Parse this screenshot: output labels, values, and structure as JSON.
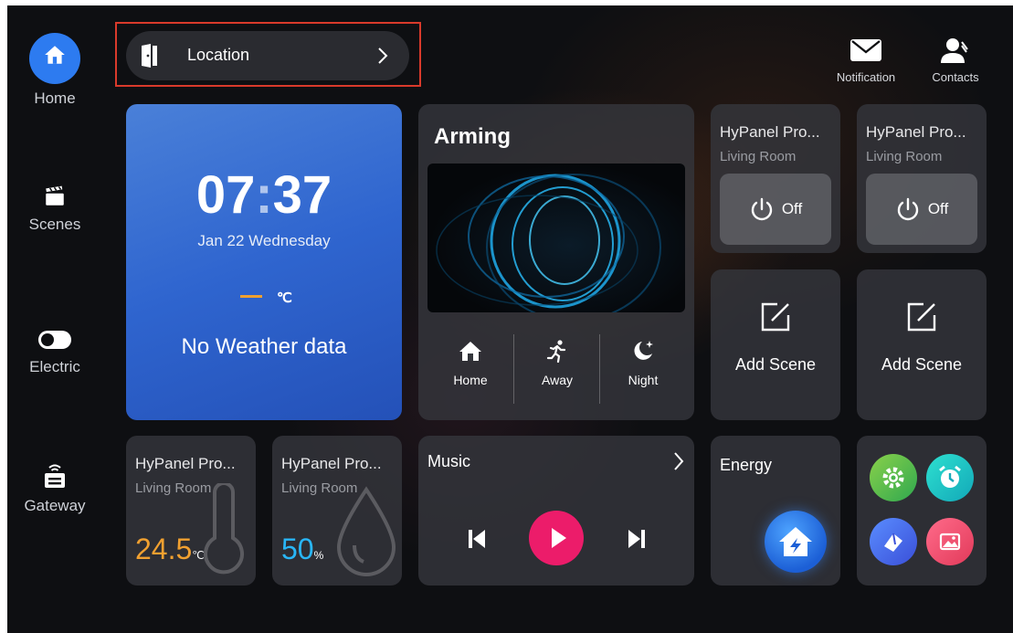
{
  "sidebar": {
    "items": [
      {
        "label": "Home",
        "icon": "home-icon"
      },
      {
        "label": "Scenes",
        "icon": "clapperboard-icon"
      },
      {
        "label": "Electric",
        "icon": "toggle-icon"
      },
      {
        "label": "Gateway",
        "icon": "gateway-icon"
      }
    ]
  },
  "header": {
    "location_label": "Location",
    "notification_label": "Notification",
    "contacts_label": "Contacts"
  },
  "clock": {
    "time_h": "07",
    "time_sep": ":",
    "time_m": "37",
    "date": "Jan 22 Wednesday",
    "temp_unit": "℃",
    "weather": "No Weather data"
  },
  "arming": {
    "title": "Arming",
    "modes": [
      "Home",
      "Away",
      "Night"
    ]
  },
  "devices": [
    {
      "title": "HyPanel Pro...",
      "room": "Living Room",
      "state": "Off"
    },
    {
      "title": "HyPanel Pro...",
      "room": "Living Room",
      "state": "Off"
    }
  ],
  "scenes": [
    {
      "label": "Add Scene"
    },
    {
      "label": "Add Scene"
    }
  ],
  "sensors": [
    {
      "title": "HyPanel Pro...",
      "room": "Living Room",
      "value": "24.5",
      "unit": "℃"
    },
    {
      "title": "HyPanel Pro...",
      "room": "Living Room",
      "value": "50",
      "unit": "%"
    }
  ],
  "music": {
    "title": "Music"
  },
  "energy": {
    "title": "Energy"
  },
  "colors": {
    "accent_blue": "#2d7bf0",
    "temp_orange": "#f0a030",
    "humidity_blue": "#29b6f6",
    "play_pink": "#ec1c6a",
    "highlight_red": "#d93a2b"
  }
}
